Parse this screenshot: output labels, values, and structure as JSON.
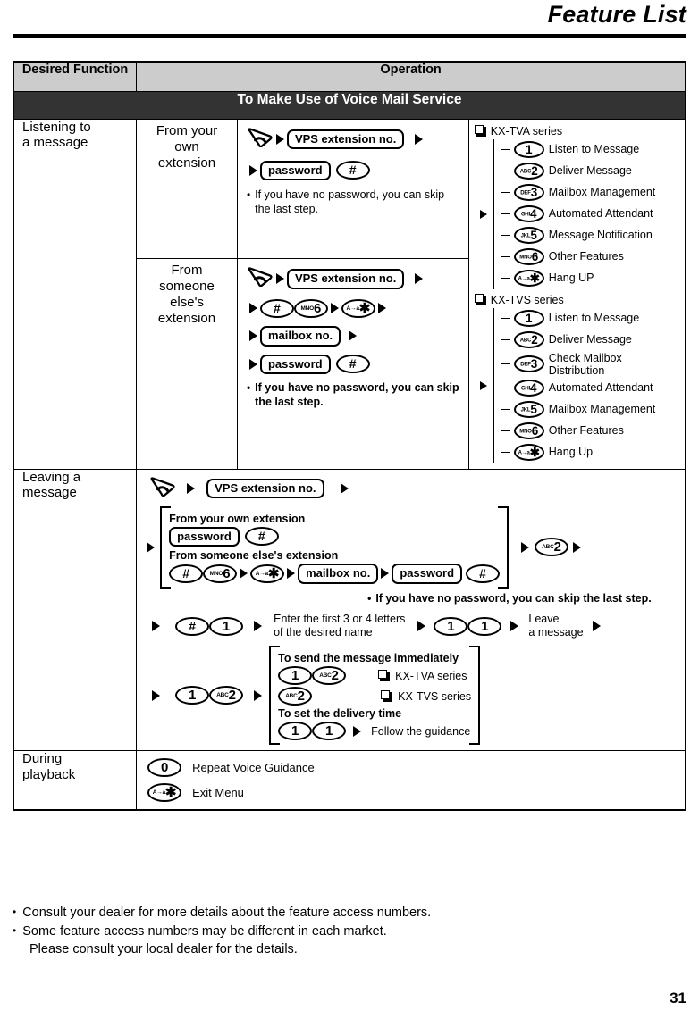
{
  "header": {
    "title": "Feature List"
  },
  "table": {
    "columns": {
      "desired_function": "Desired Function",
      "operation": "Operation"
    },
    "section_title": "To Make Use of Voice Mail Service"
  },
  "rows": {
    "listening": {
      "function_label": "Listening to\na message",
      "sub_own": {
        "label": "From your\nown\nextension",
        "step_handset": "lift-handset-icon",
        "step_vps": "VPS extension no.",
        "step_password": "password",
        "step_hash": "#",
        "note": "If you have no password, you can skip the last step."
      },
      "sub_other": {
        "label": "From\nsomeone\nelse's\nextension",
        "step_handset": "lift-handset-icon",
        "step_vps": "VPS extension no.",
        "step_hash": "#",
        "step_6": "6",
        "step_6_letters": "MNO",
        "step_star": "✱",
        "step_star_letters": "A→a",
        "step_mailbox": "mailbox no.",
        "step_password": "password",
        "step_hash2": "#",
        "note": "If you have no password, you can skip the last step."
      },
      "series": [
        {
          "name": "KX-TVA series",
          "items": [
            {
              "letters": "",
              "digit": "1",
              "label": "Listen to Message"
            },
            {
              "letters": "ABC",
              "digit": "2",
              "label": "Deliver Message"
            },
            {
              "letters": "DEF",
              "digit": "3",
              "label": "Mailbox Management"
            },
            {
              "letters": "GHI",
              "digit": "4",
              "label": "Automated Attendant"
            },
            {
              "letters": "JKL",
              "digit": "5",
              "label": "Message Notification"
            },
            {
              "letters": "MNO",
              "digit": "6",
              "label": "Other Features"
            },
            {
              "letters": "A→a",
              "digit": "✱",
              "label": "Hang UP"
            }
          ]
        },
        {
          "name": "KX-TVS series",
          "items": [
            {
              "letters": "",
              "digit": "1",
              "label": "Listen to Message"
            },
            {
              "letters": "ABC",
              "digit": "2",
              "label": "Deliver Message"
            },
            {
              "letters": "DEF",
              "digit": "3",
              "label": "Check Mailbox\nDistribution"
            },
            {
              "letters": "GHI",
              "digit": "4",
              "label": "Automated Attendant"
            },
            {
              "letters": "JKL",
              "digit": "5",
              "label": "Mailbox Management"
            },
            {
              "letters": "MNO",
              "digit": "6",
              "label": "Other Features"
            },
            {
              "letters": "A→a",
              "digit": "✱",
              "label": "Hang Up"
            }
          ]
        }
      ]
    },
    "leaving": {
      "function_label": "Leaving a\nmessage",
      "step_handset": "lift-handset-icon",
      "step_vps": "VPS extension no.",
      "bracket": {
        "heading_own": "From your own extension",
        "own_password": "password",
        "own_hash": "#",
        "heading_other": "From someone else's extension",
        "other_hash": "#",
        "other_6": "6",
        "other_6_letters": "MNO",
        "other_star": "✱",
        "other_star_letters": "A→a",
        "other_mailbox": "mailbox no.",
        "other_password": "password",
        "other_hash2": "#",
        "note": "If you have no password, you can skip the last step."
      },
      "after_bracket_key": "2",
      "after_bracket_key_letters": "ABC",
      "line2": {
        "hash": "#",
        "one": "1",
        "text": "Enter the first 3 or 4 letters\nof the desired name",
        "one_a": "1",
        "one_b": "1",
        "leave": "Leave\na message"
      },
      "line3": {
        "one": "1",
        "two": "2",
        "two_letters": "ABC",
        "box": {
          "heading_immediate": "To send the message immediately",
          "tva_keys": [
            "1",
            "2"
          ],
          "tva_key_letters": [
            "",
            "ABC"
          ],
          "tva_label": "KX-TVA series",
          "tvs_keys": [
            "2"
          ],
          "tvs_key_letters": [
            "ABC"
          ],
          "tvs_label": "KX-TVS series",
          "heading_delivery": "To set the delivery time",
          "delivery_keys": [
            "1",
            "1"
          ],
          "delivery_text": "Follow the guidance"
        }
      }
    },
    "playback": {
      "function_label": "During\nplayback",
      "items": [
        {
          "letters": "",
          "digit": "0",
          "label": "Repeat Voice Guidance"
        },
        {
          "letters": "A→a",
          "digit": "✱",
          "label": "Exit Menu"
        }
      ]
    }
  },
  "footer": {
    "notes": [
      "Consult your dealer for more details about the feature access numbers.",
      "Some feature access numbers may be different in each market."
    ],
    "note2_continuation": "Please consult your local dealer for the details.",
    "page_number": "31"
  },
  "colors": {
    "header_grey": "#cccccc",
    "section_dark": "#333333",
    "ink": "#000000",
    "paper": "#ffffff"
  }
}
